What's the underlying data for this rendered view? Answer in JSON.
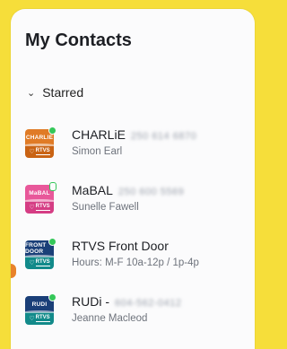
{
  "header": {
    "title": "My Contacts"
  },
  "section": {
    "label": "Starred",
    "chevron": "chevron-down"
  },
  "colors": {
    "background": "#f6de3a",
    "online": "#35c759",
    "accent_orange": "#e8822a"
  },
  "contacts": [
    {
      "name": "CHARLiE",
      "phone": "250 614 6870",
      "subtitle": "Simon Earl",
      "avatar_label": "CHARLIE",
      "avatar_footer": "RTVS",
      "avatar_colors": [
        "#e07b26",
        "#c96314"
      ],
      "presence": "online"
    },
    {
      "name": "MaBAL",
      "phone": "250 600 5569",
      "subtitle": "Sunelle Fawell",
      "avatar_label": "MaBAL",
      "avatar_footer": "RTVS",
      "avatar_colors": [
        "#e8589a",
        "#d53d84"
      ],
      "presence": "away"
    },
    {
      "name": "RTVS Front Door",
      "phone": "",
      "subtitle": "Hours: M-F 10a-12p / 1p-4p",
      "avatar_label": "FRONT DOOR",
      "avatar_footer": "RTVS",
      "avatar_colors": [
        "#1a3f78",
        "#128a8a"
      ],
      "presence": "online"
    },
    {
      "name": "RUDi -",
      "phone": "604-562-0412",
      "subtitle": "Jeanne Macleod",
      "avatar_label": "RUDI",
      "avatar_footer": "RTVS",
      "avatar_colors": [
        "#1a3f78",
        "#128a8a"
      ],
      "presence": "online"
    }
  ]
}
